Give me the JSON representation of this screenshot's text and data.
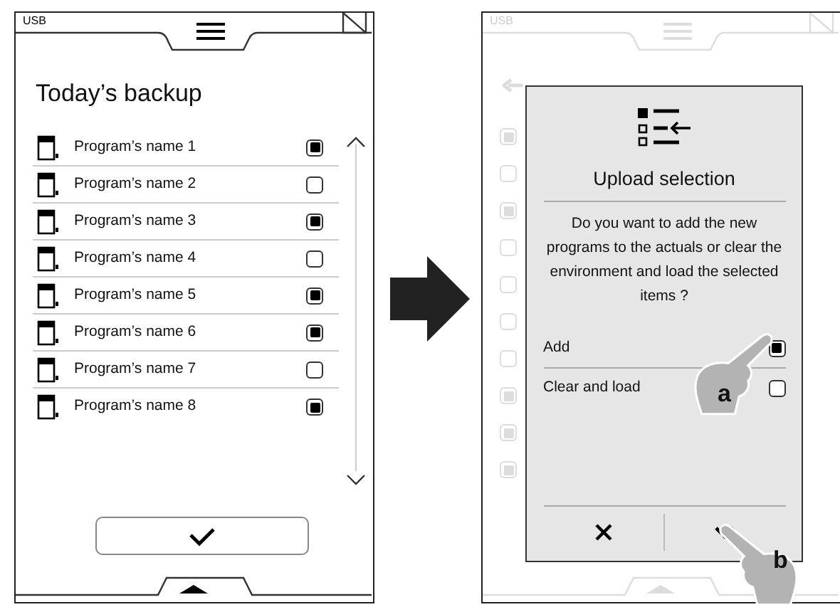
{
  "left_screen": {
    "status": "USB",
    "title": "Today’s backup",
    "programs": [
      {
        "name": "Program’s name 1",
        "checked": true
      },
      {
        "name": "Program’s name 2",
        "checked": false
      },
      {
        "name": "Program’s name 3",
        "checked": true
      },
      {
        "name": "Program’s name 4",
        "checked": false
      },
      {
        "name": "Program’s name 5",
        "checked": true
      },
      {
        "name": "Program’s name 6",
        "checked": true
      },
      {
        "name": "Program’s name 7",
        "checked": false
      },
      {
        "name": "Program’s name 8",
        "checked": true
      }
    ]
  },
  "right_screen": {
    "status": "USB",
    "background_checkboxes": [
      {
        "checked": true
      },
      {
        "checked": false
      },
      {
        "checked": true
      },
      {
        "checked": false
      },
      {
        "checked": false
      },
      {
        "checked": false
      },
      {
        "checked": false
      },
      {
        "checked": true
      },
      {
        "checked": true
      },
      {
        "checked": true
      }
    ]
  },
  "dialog": {
    "title": "Upload selection",
    "message": "Do you want to add the new programs to the actuals or clear the environment and load the selected items ?",
    "options": [
      {
        "label": "Add",
        "checked": true
      },
      {
        "label": "Clear and load",
        "checked": false
      }
    ]
  },
  "callouts": [
    "a",
    "b"
  ]
}
